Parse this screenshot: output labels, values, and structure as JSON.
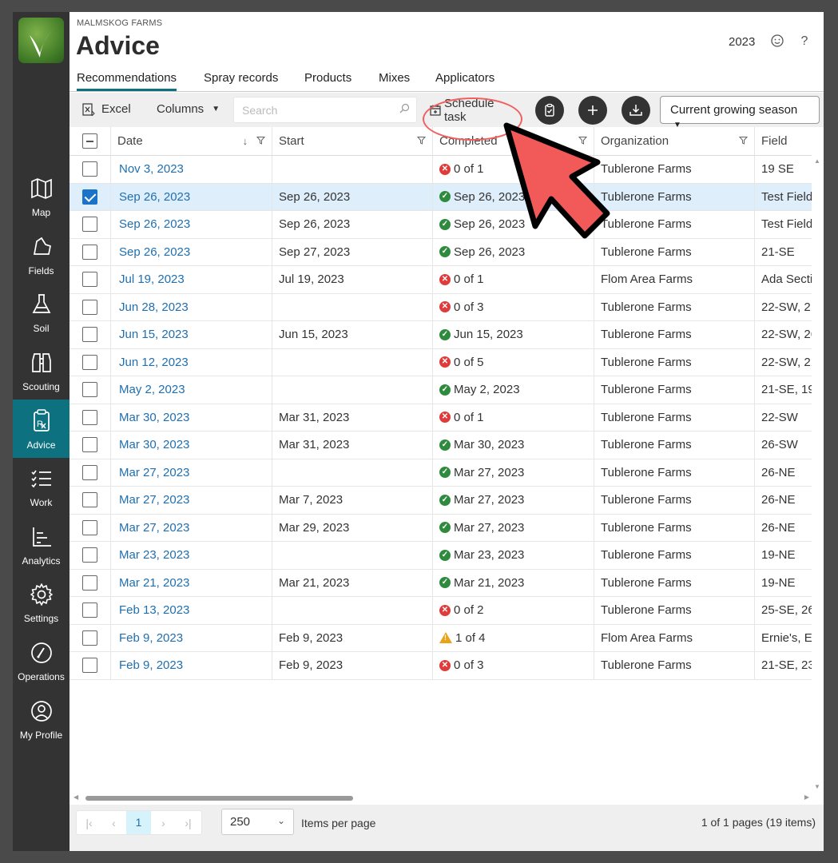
{
  "app": {
    "farm_name": "MALMSKOG FARMS",
    "title": "Advice",
    "year": "2023"
  },
  "sidebar": {
    "items": [
      {
        "label": "Map",
        "icon": "map-icon",
        "active": false
      },
      {
        "label": "Fields",
        "icon": "fields-icon",
        "active": false
      },
      {
        "label": "Soil",
        "icon": "flask-icon",
        "active": false
      },
      {
        "label": "Scouting",
        "icon": "binoculars-icon",
        "active": false
      },
      {
        "label": "Advice",
        "icon": "prescription-icon",
        "active": true
      },
      {
        "label": "Work",
        "icon": "checklist-icon",
        "active": false
      },
      {
        "label": "Analytics",
        "icon": "bar-chart-icon",
        "active": false
      },
      {
        "label": "Settings",
        "icon": "gear-icon",
        "active": false
      },
      {
        "label": "Operations",
        "icon": "gauge-icon",
        "active": false
      },
      {
        "label": "My Profile",
        "icon": "user-icon",
        "active": false
      }
    ]
  },
  "tabs": [
    "Recommendations",
    "Spray records",
    "Products",
    "Mixes",
    "Applicators"
  ],
  "toolbar": {
    "excel": "Excel",
    "columns": "Columns",
    "search_placeholder": "Search",
    "schedule_task": "Schedule task",
    "season": "Current growing season"
  },
  "grid": {
    "columns": [
      "Date",
      "Start",
      "Completed",
      "Organization",
      "Field"
    ],
    "rows": [
      {
        "date": "Nov 3, 2023",
        "start": "",
        "status": "err",
        "completed": "0 of 1",
        "org": "Tublerone Farms",
        "field": "19 SE",
        "selected": false
      },
      {
        "date": "Sep 26, 2023",
        "start": "Sep 26, 2023",
        "status": "ok",
        "completed": "Sep 26, 2023",
        "org": "Tublerone Farms",
        "field": "Test Field",
        "selected": true
      },
      {
        "date": "Sep 26, 2023",
        "start": "Sep 26, 2023",
        "status": "ok",
        "completed": "Sep 26, 2023",
        "org": "Tublerone Farms",
        "field": "Test Field",
        "selected": false
      },
      {
        "date": "Sep 26, 2023",
        "start": "Sep 27, 2023",
        "status": "ok",
        "completed": "Sep 26, 2023",
        "org": "Tublerone Farms",
        "field": "21-SE",
        "selected": false
      },
      {
        "date": "Jul 19, 2023",
        "start": "Jul 19, 2023",
        "status": "err",
        "completed": "0 of 1",
        "org": "Flom Area Farms",
        "field": "Ada Secti",
        "selected": false
      },
      {
        "date": "Jun 28, 2023",
        "start": "",
        "status": "err",
        "completed": "0 of 3",
        "org": "Tublerone Farms",
        "field": "22-SW, 21",
        "selected": false
      },
      {
        "date": "Jun 15, 2023",
        "start": "Jun 15, 2023",
        "status": "ok",
        "completed": "Jun 15, 2023",
        "org": "Tublerone Farms",
        "field": "22-SW, 26",
        "selected": false
      },
      {
        "date": "Jun 12, 2023",
        "start": "",
        "status": "err",
        "completed": "0 of 5",
        "org": "Tublerone Farms",
        "field": "22-SW, 21",
        "selected": false
      },
      {
        "date": "May 2, 2023",
        "start": "",
        "status": "ok",
        "completed": "May 2, 2023",
        "org": "Tublerone Farms",
        "field": "21-SE, 19-",
        "selected": false
      },
      {
        "date": "Mar 30, 2023",
        "start": "Mar 31, 2023",
        "status": "err",
        "completed": "0 of 1",
        "org": "Tublerone Farms",
        "field": "22-SW",
        "selected": false
      },
      {
        "date": "Mar 30, 2023",
        "start": "Mar 31, 2023",
        "status": "ok",
        "completed": "Mar 30, 2023",
        "org": "Tublerone Farms",
        "field": "26-SW",
        "selected": false
      },
      {
        "date": "Mar 27, 2023",
        "start": "",
        "status": "ok",
        "completed": "Mar 27, 2023",
        "org": "Tublerone Farms",
        "field": "26-NE",
        "selected": false
      },
      {
        "date": "Mar 27, 2023",
        "start": "Mar 7, 2023",
        "status": "ok",
        "completed": "Mar 27, 2023",
        "org": "Tublerone Farms",
        "field": "26-NE",
        "selected": false
      },
      {
        "date": "Mar 27, 2023",
        "start": "Mar 29, 2023",
        "status": "ok",
        "completed": "Mar 27, 2023",
        "org": "Tublerone Farms",
        "field": "26-NE",
        "selected": false
      },
      {
        "date": "Mar 23, 2023",
        "start": "",
        "status": "ok",
        "completed": "Mar 23, 2023",
        "org": "Tublerone Farms",
        "field": "19-NE",
        "selected": false
      },
      {
        "date": "Mar 21, 2023",
        "start": "Mar 21, 2023",
        "status": "ok",
        "completed": "Mar 21, 2023",
        "org": "Tublerone Farms",
        "field": "19-NE",
        "selected": false
      },
      {
        "date": "Feb 13, 2023",
        "start": "",
        "status": "err",
        "completed": "0 of 2",
        "org": "Tublerone Farms",
        "field": "25-SE, 26-",
        "selected": false
      },
      {
        "date": "Feb 9, 2023",
        "start": "Feb 9, 2023",
        "status": "warn",
        "completed": "1 of 4",
        "org": "Flom Area Farms",
        "field": "Ernie's, E",
        "selected": false
      },
      {
        "date": "Feb 9, 2023",
        "start": "Feb 9, 2023",
        "status": "err",
        "completed": "0 of 3",
        "org": "Tublerone Farms",
        "field": "21-SE, 23-",
        "selected": false
      }
    ]
  },
  "pager": {
    "current_page": "1",
    "page_size": "250",
    "items_per_page": "Items per page",
    "info": "1 of 1 pages (19 items)"
  },
  "colors": {
    "accent": "#0d7180",
    "link": "#1f6fb0",
    "annotation": "#f25a5a",
    "ok": "#2e8b3d",
    "err": "#e03a3a",
    "warn": "#e8a317"
  }
}
